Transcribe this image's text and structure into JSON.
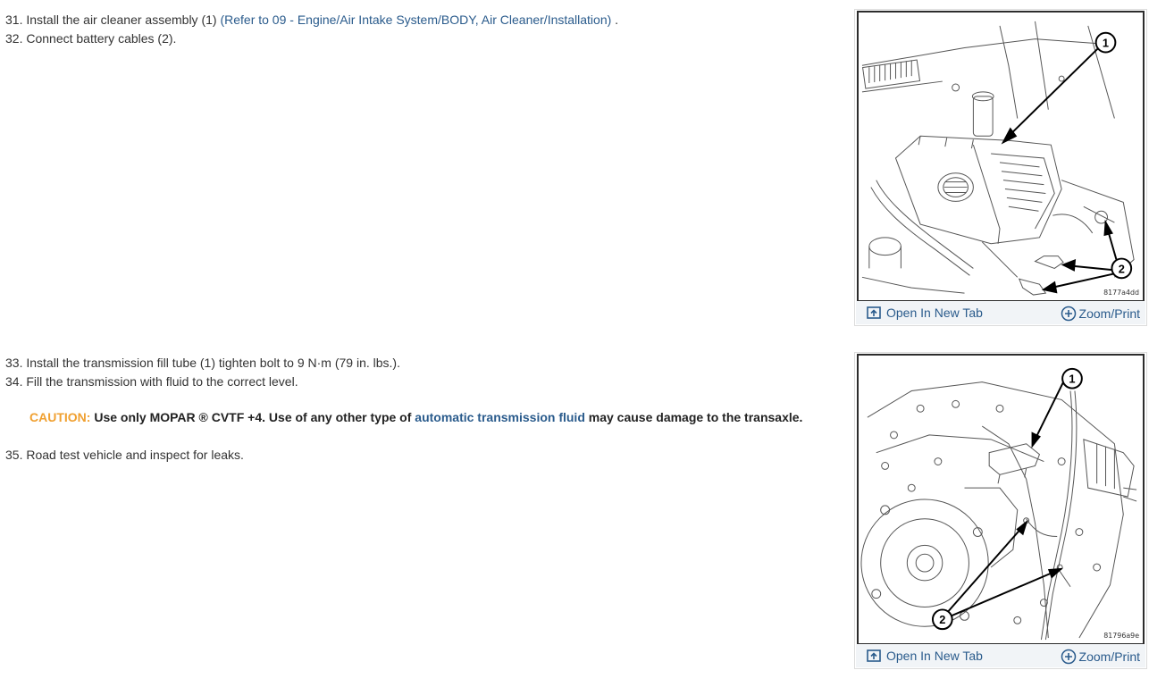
{
  "steps": {
    "s31": {
      "text": "31. Install the air cleaner assembly (1) ",
      "link": "(Refer to 09 - Engine/Air Intake System/BODY, Air Cleaner/Installation)",
      "tail": " ."
    },
    "s32": "32. Connect battery cables (2).",
    "s33": "33. Install the transmission fill tube (1) tighten bolt to 9 N·m (79 in. lbs.).",
    "s34": "34. Fill the transmission with fluid to the correct level.",
    "s35": "35. Road test vehicle and inspect for leaks."
  },
  "caution": {
    "label": "CAUTION:",
    "text_before": " Use only MOPAR ® CVTF +4. Use of any other type of ",
    "link": "automatic transmission fluid",
    "text_after": " may cause damage to the transaxle."
  },
  "figures": [
    {
      "id_label": "8177a4dd",
      "callout_1": "1",
      "callout_2": "2",
      "open_label": "Open In New Tab",
      "zoom_label": "Zoom/Print"
    },
    {
      "id_label": "81796a9e",
      "callout_1": "1",
      "callout_2": "2",
      "open_label": "Open In New Tab",
      "zoom_label": "Zoom/Print"
    }
  ],
  "colors": {
    "link": "#2a5b8c",
    "caution": "#f0a030",
    "bar_bg": "#f1f4f7"
  },
  "icons": {
    "open": "open-in-new-tab-icon",
    "zoom": "zoom-plus-icon"
  }
}
